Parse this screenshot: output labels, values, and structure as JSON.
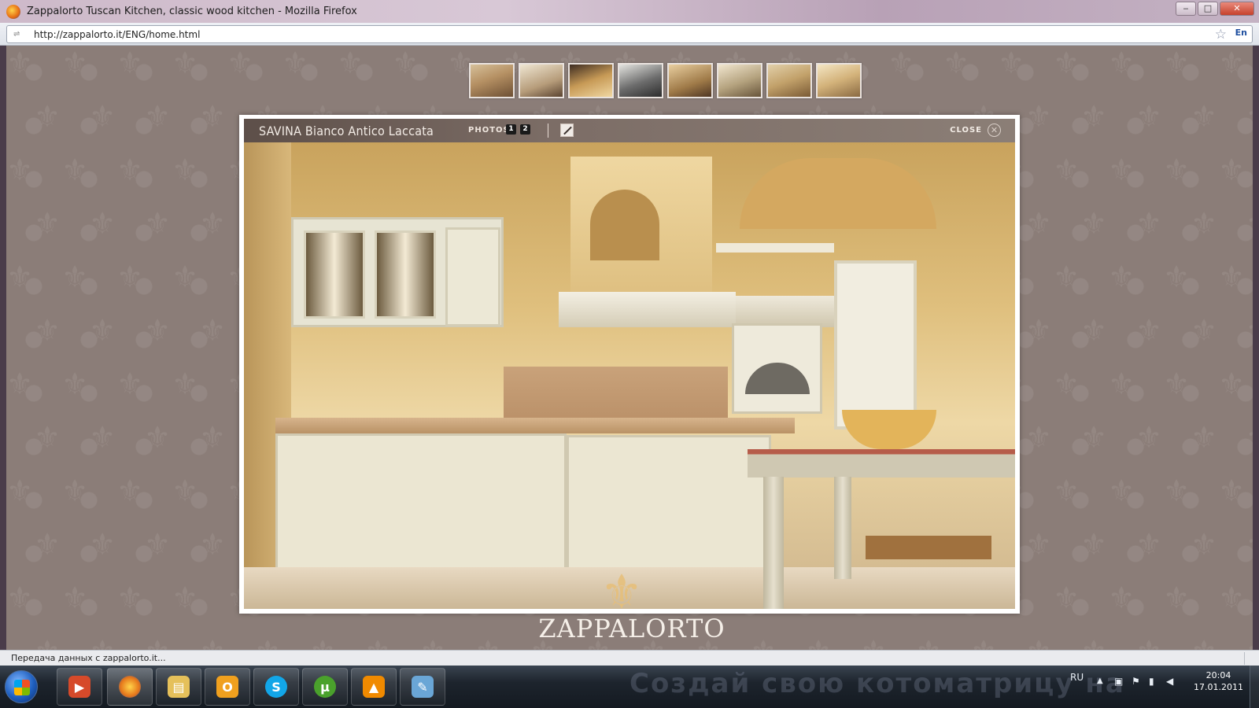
{
  "window": {
    "title": "Zappalorto Tuscan Kitchen, classic wood kitchen - Mozilla Firefox",
    "minimize": "‒",
    "maximize": "□",
    "close": "✕"
  },
  "browser": {
    "url": "http://zappalorto.it/ENG/home.html",
    "lang_indicator": "En"
  },
  "page": {
    "thumbnails_count": 8,
    "viewer": {
      "title": "SAVINA Bianco Antico Laccata",
      "photos_label": "PHOTOS",
      "photo_numbers": [
        "1",
        "2"
      ],
      "close_label": "CLOSE"
    },
    "logo": "ZAPPALORTO"
  },
  "status": {
    "text": "Передача данных с zappalorto.it..."
  },
  "taskbar": {
    "apps": [
      {
        "name": "media-player",
        "color": "#d64a2a"
      },
      {
        "name": "firefox",
        "color": "#e5761a"
      },
      {
        "name": "explorer",
        "color": "#e5c05a"
      },
      {
        "name": "outlook",
        "color": "#f0a01e"
      },
      {
        "name": "skype",
        "color": "#12a6e8"
      },
      {
        "name": "utorrent",
        "color": "#4aa12c"
      },
      {
        "name": "vlc",
        "color": "#f08a00"
      },
      {
        "name": "paint",
        "color": "#6aa6d6"
      }
    ],
    "watermark": "Создай свою котоматрицу на",
    "tray_lang": "RU",
    "clock_time": "20:04",
    "clock_date": "17.01.2011"
  }
}
